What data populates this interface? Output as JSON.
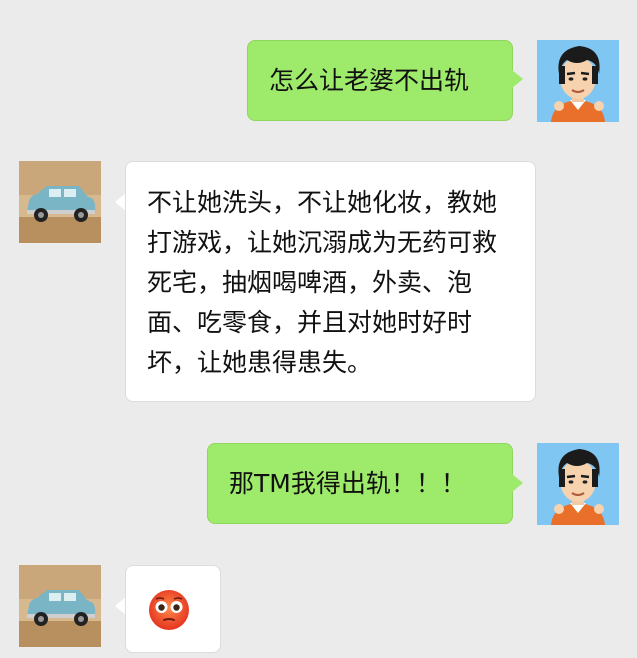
{
  "messages": [
    {
      "side": "out",
      "text": "怎么让老婆不出轨",
      "avatar": "self-avatar-cartoon-man"
    },
    {
      "side": "in",
      "text": "不让她洗头，不让她化妆，教她打游戏，让她沉溺成为无药可救死宅，抽烟喝啤酒，外卖、泡面、吃零食，并且对她时好时坏，让她患得患失。",
      "avatar": "friend-avatar-blue-car"
    },
    {
      "side": "out",
      "text": "那TM我得出轨！！！",
      "avatar": "self-avatar-cartoon-man"
    },
    {
      "side": "in",
      "emoji": "flushed-face-emoji",
      "avatar": "friend-avatar-blue-car"
    }
  ],
  "colors": {
    "background": "#ebebeb",
    "outgoing_bubble": "#9eea6a",
    "incoming_bubble": "#ffffff"
  }
}
